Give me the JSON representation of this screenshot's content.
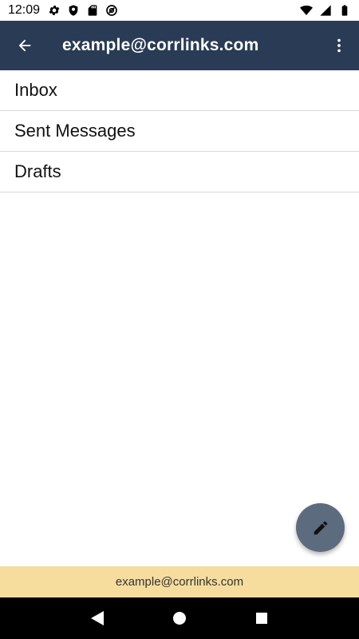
{
  "status_bar": {
    "time": "12:09",
    "icons_left": [
      "gear-icon",
      "shield-icon",
      "sd-card-icon",
      "at-sign-icon"
    ],
    "icons_right": [
      "wifi-icon",
      "signal-icon",
      "battery-icon"
    ]
  },
  "app_bar": {
    "title": "example@corrlinks.com",
    "background": "#2a3b55"
  },
  "folders": {
    "items": [
      {
        "label": "Inbox"
      },
      {
        "label": "Sent Messages"
      },
      {
        "label": "Drafts"
      }
    ]
  },
  "fab": {
    "icon": "pencil-icon",
    "color": "#5d6b7f"
  },
  "footer": {
    "account": "example@corrlinks.com",
    "background": "#f6dd9e"
  },
  "nav_bar": {
    "buttons": [
      "back-triangle-icon",
      "home-circle-icon",
      "recents-square-icon"
    ]
  }
}
